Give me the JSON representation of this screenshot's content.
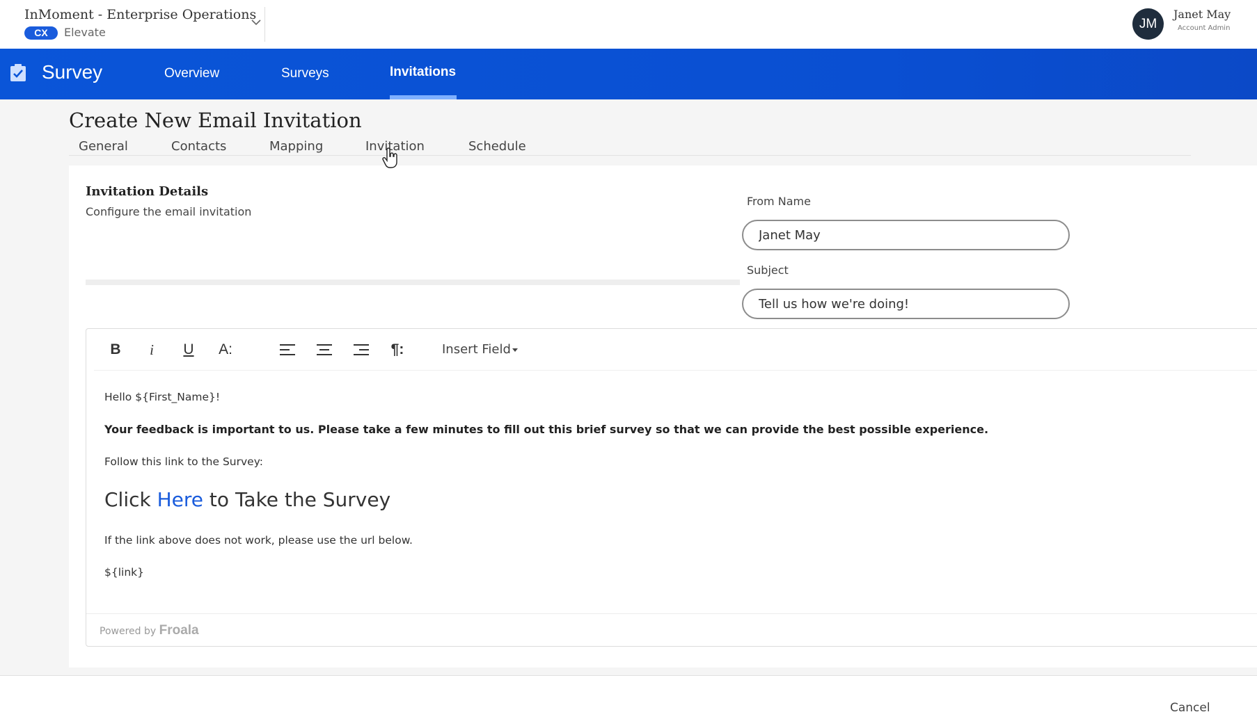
{
  "header": {
    "org_title": "InMoment - Enterprise Operations",
    "badge": "CX",
    "product": "Elevate",
    "user": {
      "initials": "JM",
      "name": "Janet May",
      "role": "Account Admin"
    }
  },
  "nav": {
    "app_title": "Survey",
    "tabs": [
      {
        "label": "Overview"
      },
      {
        "label": "Surveys"
      },
      {
        "label": "Invitations",
        "active": true
      }
    ],
    "accent": "#0a55d8"
  },
  "page": {
    "title": "Create New Email Invitation",
    "subtabs": [
      {
        "label": "General"
      },
      {
        "label": "Contacts"
      },
      {
        "label": "Mapping"
      },
      {
        "label": "Invitation"
      },
      {
        "label": "Schedule"
      }
    ]
  },
  "details": {
    "title": "Invitation Details",
    "description": "Configure the email invitation"
  },
  "form": {
    "from_name_label": "From Name",
    "from_name_value": "Janet May",
    "subject_label": "Subject",
    "subject_value": "Tell us how we're doing!"
  },
  "editor": {
    "toolbar": {
      "bold": "B",
      "italic": "i",
      "underline": "U",
      "font_size": "A:",
      "paragraph": "¶:",
      "insert_field": "Insert Field"
    },
    "body": {
      "greeting": "Hello ${First_Name}!",
      "feedback": "Your feedback is important to us. Please take a few minutes to fill out this brief survey so that we can provide the best possible experience.",
      "follow": "Follow this link to the Survey:",
      "link_prefix": "Click ",
      "link_text": "Here",
      "link_suffix": " to Take the Survey",
      "fallback": "If the link above does not work, please use the url below.",
      "link_var": "${link}"
    },
    "powered_by": "Powered by",
    "powered_brand": "Froala"
  },
  "footer": {
    "cancel": "Cancel"
  }
}
